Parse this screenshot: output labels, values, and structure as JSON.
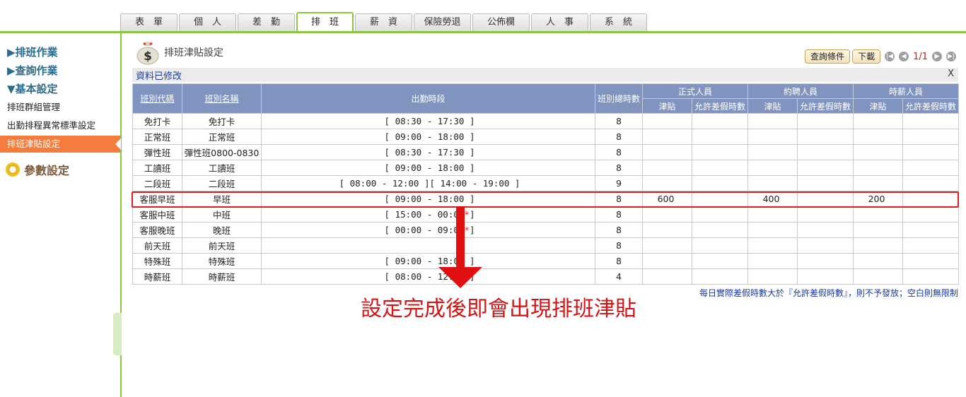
{
  "tabs": [
    "表　單",
    "個　人",
    "差　勤",
    "排　班",
    "薪　資",
    "保險勞退",
    "公佈欄",
    "人　事",
    "系　統"
  ],
  "sidebar": {
    "menu1": "▶排班作業",
    "menu2": "▶查詢作業",
    "menu3": "▼基本設定",
    "items": [
      "排班群組管理",
      "出勤排程異常標準設定",
      "排班津貼設定"
    ],
    "param": "參數設定"
  },
  "header": {
    "title": "排班津貼設定",
    "query_button": "查詢條件",
    "download_button": "下載",
    "page_info": "1/1"
  },
  "status": {
    "message": "資料已修改",
    "close": "X"
  },
  "table": {
    "col_code": "班別代碼",
    "col_name": "班別名稱",
    "col_period": "出勤時段",
    "col_total": "班別總時數",
    "group_formal": "正式人員",
    "group_contract": "約聘人員",
    "group_hourly": "時薪人員",
    "sub_allowance": "津貼",
    "sub_leave": "允許差假時數",
    "rows": [
      {
        "code": "免打卡",
        "name": "免打卡",
        "period": "[ 08:30 - 17:30 ]",
        "hours": "8",
        "f_allow": "",
        "f_leave": "",
        "c_allow": "",
        "c_leave": "",
        "h_allow": "",
        "h_leave": ""
      },
      {
        "code": "正常班",
        "name": "正常班",
        "period": "[ 09:00 - 18:00 ]",
        "hours": "8",
        "f_allow": "",
        "f_leave": "",
        "c_allow": "",
        "c_leave": "",
        "h_allow": "",
        "h_leave": ""
      },
      {
        "code": "彈性班",
        "name": "彈性班0800-0830",
        "period": "[ 08:30 - 17:30 ]",
        "hours": "8",
        "f_allow": "",
        "f_leave": "",
        "c_allow": "",
        "c_leave": "",
        "h_allow": "",
        "h_leave": ""
      },
      {
        "code": "工讀班",
        "name": "工讀班",
        "period": "[ 09:00 - 18:00 ]",
        "hours": "8",
        "f_allow": "",
        "f_leave": "",
        "c_allow": "",
        "c_leave": "",
        "h_allow": "",
        "h_leave": ""
      },
      {
        "code": "二段班",
        "name": "二段班",
        "period": "[ 08:00 - 12:00 ][ 14:00 - 19:00 ]",
        "hours": "9",
        "f_allow": "",
        "f_leave": "",
        "c_allow": "",
        "c_leave": "",
        "h_allow": "",
        "h_leave": ""
      },
      {
        "code": "客服早班",
        "name": "早班",
        "period": "[ 09:00 - 18:00 ]",
        "hours": "8",
        "f_allow": "600",
        "f_leave": "",
        "c_allow": "400",
        "c_leave": "",
        "h_allow": "200",
        "h_leave": ""
      },
      {
        "code": "客服中班",
        "name": "中班",
        "period": "[ 15:00 - 00:00",
        "star": "*",
        "period_end": "]",
        "hours": "8",
        "f_allow": "",
        "f_leave": "",
        "c_allow": "",
        "c_leave": "",
        "h_allow": "",
        "h_leave": ""
      },
      {
        "code": "客服晚班",
        "name": "晚班",
        "period": "[ 00:00 - 09:00",
        "star": "*",
        "period_end": "]",
        "hours": "8",
        "f_allow": "",
        "f_leave": "",
        "c_allow": "",
        "c_leave": "",
        "h_allow": "",
        "h_leave": ""
      },
      {
        "code": "前天班",
        "name": "前天班",
        "period": "",
        "hours": "8",
        "f_allow": "",
        "f_leave": "",
        "c_allow": "",
        "c_leave": "",
        "h_allow": "",
        "h_leave": ""
      },
      {
        "code": "特殊班",
        "name": "特殊班",
        "period": "[ 09:00 - 18:00 ]",
        "hours": "8",
        "f_allow": "",
        "f_leave": "",
        "c_allow": "",
        "c_leave": "",
        "h_allow": "",
        "h_leave": ""
      },
      {
        "code": "時薪班",
        "name": "時薪班",
        "period": "[ 08:00 - 12:00 ]",
        "hours": "4",
        "f_allow": "",
        "f_leave": "",
        "c_allow": "",
        "c_leave": "",
        "h_allow": "",
        "h_leave": ""
      }
    ]
  },
  "note": "每日實際差假時數大於『允許差假時數』，則不予發放；空白則無限制",
  "annotation": "設定完成後即會出現排班津貼",
  "colors": {
    "accent_green": "#8cc63f",
    "header_blue": "#8194bf",
    "active_orange": "#f47c3c",
    "highlight_red": "#e02020"
  }
}
